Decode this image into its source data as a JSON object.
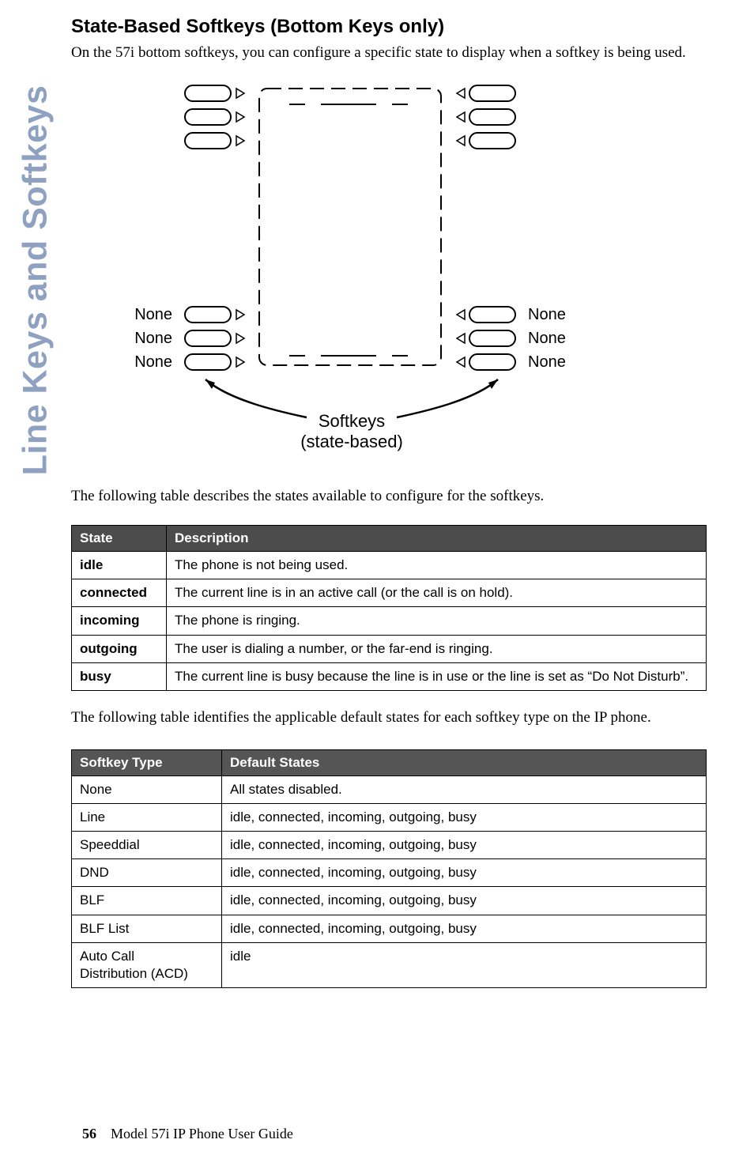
{
  "sidebar_label": "Line Keys and Softkeys",
  "heading": "State-Based Softkeys (Bottom Keys only)",
  "intro": "On the 57i bottom softkeys, you can configure a specific state to display when a softkey is being used.",
  "diagram": {
    "side_label": "None",
    "caption_top": "Softkeys",
    "caption_bottom": "(state-based)"
  },
  "states_intro": "The following table describes the states available to configure for the softkeys.",
  "states_table": {
    "headers": [
      "State",
      "Description"
    ],
    "rows": [
      [
        "idle",
        "The phone is not being used."
      ],
      [
        "connected",
        "The current line is in an active call (or the call is on hold)."
      ],
      [
        "incoming",
        "The phone is ringing."
      ],
      [
        "outgoing",
        "The user is dialing a number, or the far-end is ringing."
      ],
      [
        "busy",
        "The current line is busy because the line is in use or the line is set as “Do Not Disturb”."
      ]
    ]
  },
  "types_intro": "The following table identifies the applicable default states for each softkey type on the IP phone.",
  "types_table": {
    "headers": [
      "Softkey Type",
      "Default States"
    ],
    "rows": [
      [
        "None",
        "All states disabled."
      ],
      [
        "Line",
        "idle, connected, incoming, outgoing, busy"
      ],
      [
        "Speeddial",
        "idle, connected, incoming, outgoing, busy"
      ],
      [
        "DND",
        "idle, connected, incoming, outgoing, busy"
      ],
      [
        "BLF",
        "idle, connected, incoming, outgoing, busy"
      ],
      [
        "BLF List",
        "idle, connected, incoming, outgoing, busy"
      ],
      [
        "Auto Call\nDistribution (ACD)",
        "idle"
      ]
    ]
  },
  "footer": {
    "page": "56",
    "title": "Model 57i IP Phone User Guide"
  }
}
